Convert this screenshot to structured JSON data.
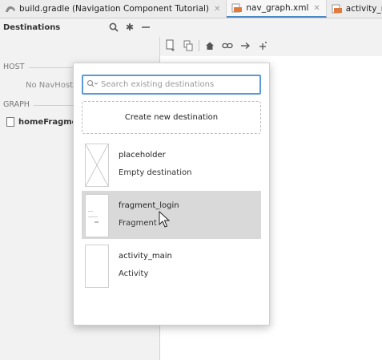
{
  "tabs": [
    {
      "label": "build.gradle (Navigation Component Tutorial)",
      "icon": "gradle-file-icon",
      "active": false
    },
    {
      "label": "nav_graph.xml",
      "icon": "xml-file-icon",
      "active": true
    },
    {
      "label": "activity_main.xm",
      "icon": "xml-file-icon",
      "active": false
    }
  ],
  "destinations_panel": {
    "title": "Destinations",
    "host_label": "HOST",
    "host_empty": "No NavHostl",
    "graph_label": "GRAPH",
    "graph_item": "homeFragmer"
  },
  "popup": {
    "search_placeholder": "Search existing destinations",
    "create_label": "Create new destination",
    "items": [
      {
        "name": "placeholder",
        "kind": "Empty destination"
      },
      {
        "name": "fragment_login",
        "kind": "Fragment"
      },
      {
        "name": "activity_main",
        "kind": "Activity"
      }
    ]
  },
  "colors": {
    "accent": "#5b9bd5",
    "selected_row": "#d9d9d9",
    "xml_icon": "#e07a3a"
  }
}
